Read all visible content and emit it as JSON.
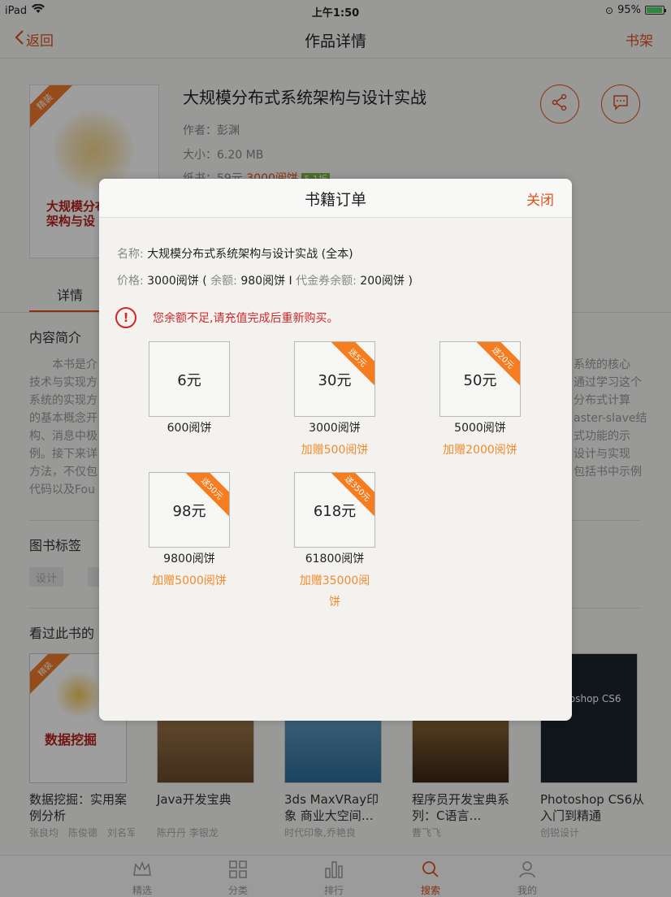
{
  "status_bar": {
    "device": "iPad",
    "time": "上午1:50",
    "battery": "95%"
  },
  "nav": {
    "back_label": "返回",
    "title": "作品详情",
    "shelf_label": "书架"
  },
  "book": {
    "cover_badge": "精装",
    "cover_title_line1": "大规模分布",
    "cover_title_line2": "架构与设",
    "title": "大规模分布式系统架构与设计实战",
    "author": "作者：彭渊",
    "size": "大小：6.20 MB",
    "paper_price": "纸书：59元",
    "ebook_price": "3000阅饼",
    "discount": "5.1折"
  },
  "tabs": {
    "detail": "详情"
  },
  "intro": {
    "heading": "内容简介",
    "lines_left": [
      "　　本书是介",
      "技术与实现方",
      "系统的实现方",
      "的基本概念开",
      "构、消息中极",
      "例。接下来详",
      "方法，不仅包",
      "代码以及Fou"
    ],
    "lines_right": [
      "系统的核心",
      "通过学习这个",
      "分布式计算",
      "aster-slave结",
      "式功能的示",
      "设计与实现",
      "包括书中示例"
    ]
  },
  "tags": {
    "heading": "图书标签",
    "items": [
      "设计"
    ]
  },
  "related": {
    "heading": "看过此书的",
    "books": [
      {
        "title": "数据挖掘：实用案例分析",
        "author": "张良均　陈俊德　刘名军　陈荣",
        "cover_text": "数据挖掘",
        "badge": "精装"
      },
      {
        "title": "Java开发宝典",
        "author": "陈丹丹 李银龙",
        "cover_text": ""
      },
      {
        "title": "3ds MaxVRay印象 商业大空间…",
        "author": "时代印象,乔艳良",
        "cover_text": ""
      },
      {
        "title": "程序员开发宝典系列：C语言…",
        "author": "曹飞飞",
        "cover_text": ""
      },
      {
        "title": "Photoshop CS6从入门到精通",
        "author": "创锐设计",
        "cover_text": "Photoshop CS6"
      }
    ]
  },
  "tab_bar": [
    {
      "label": "精选",
      "icon": "crown-icon"
    },
    {
      "label": "分类",
      "icon": "grid-icon"
    },
    {
      "label": "排行",
      "icon": "bar-chart-icon"
    },
    {
      "label": "搜索",
      "icon": "search-icon",
      "active": true
    },
    {
      "label": "我的",
      "icon": "user-icon"
    }
  ],
  "modal": {
    "title": "书籍订单",
    "close_label": "关闭",
    "name_label": "名称:",
    "name_value": "大规模分布式系统架构与设计实战 (全本)",
    "price_label": "价格:",
    "price_value": "3000阅饼 (",
    "balance_label": "余额:",
    "balance_value": "980阅饼 I",
    "voucher_label": "代金券余额:",
    "voucher_value": "200阅饼 )",
    "warning_icon": "!",
    "warning": "您余额不足,请充值完成后重新购买。",
    "options": [
      {
        "price": "6元",
        "coins": "600阅饼",
        "bonus": "",
        "corner": ""
      },
      {
        "price": "30元",
        "coins": "3000阅饼",
        "bonus": "加赠500阅饼",
        "corner": "送5元"
      },
      {
        "price": "50元",
        "coins": "5000阅饼",
        "bonus": "加赠2000阅饼",
        "corner": "送20元"
      },
      {
        "price": "98元",
        "coins": "9800阅饼",
        "bonus": "加赠5000阅饼",
        "corner": "送50元"
      },
      {
        "price": "618元",
        "coins": "61800阅饼",
        "bonus": "加赠35000阅饼",
        "corner": "送350元"
      }
    ]
  },
  "colors": {
    "accent": "#e0501c",
    "orange": "#f57c1f",
    "warning": "#d0282a"
  }
}
